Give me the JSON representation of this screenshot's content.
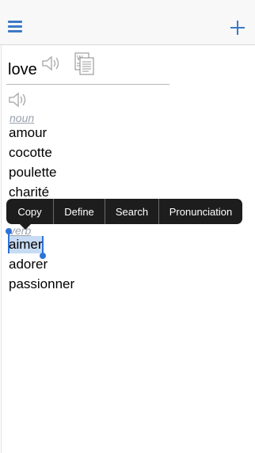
{
  "header": {
    "menu_icon": "hamburger-menu-icon",
    "add_icon": "plus-icon",
    "accent_color": "#3b7ac6"
  },
  "entry": {
    "headword": "love",
    "speaker_icon": "speaker-icon",
    "document_icon": "word-document-icon"
  },
  "sections": [
    {
      "pos": "noun",
      "words": [
        "amour",
        "cocotte",
        "poulette",
        "charité"
      ]
    },
    {
      "pos": "verb",
      "words": [
        "aimer",
        "adorer",
        "passionner"
      ]
    }
  ],
  "context_menu": {
    "items": [
      "Copy",
      "Define",
      "Search",
      "Pronunciation"
    ]
  },
  "selection": {
    "selected_word": "aimer",
    "highlight_color": "#c7dbf4"
  }
}
